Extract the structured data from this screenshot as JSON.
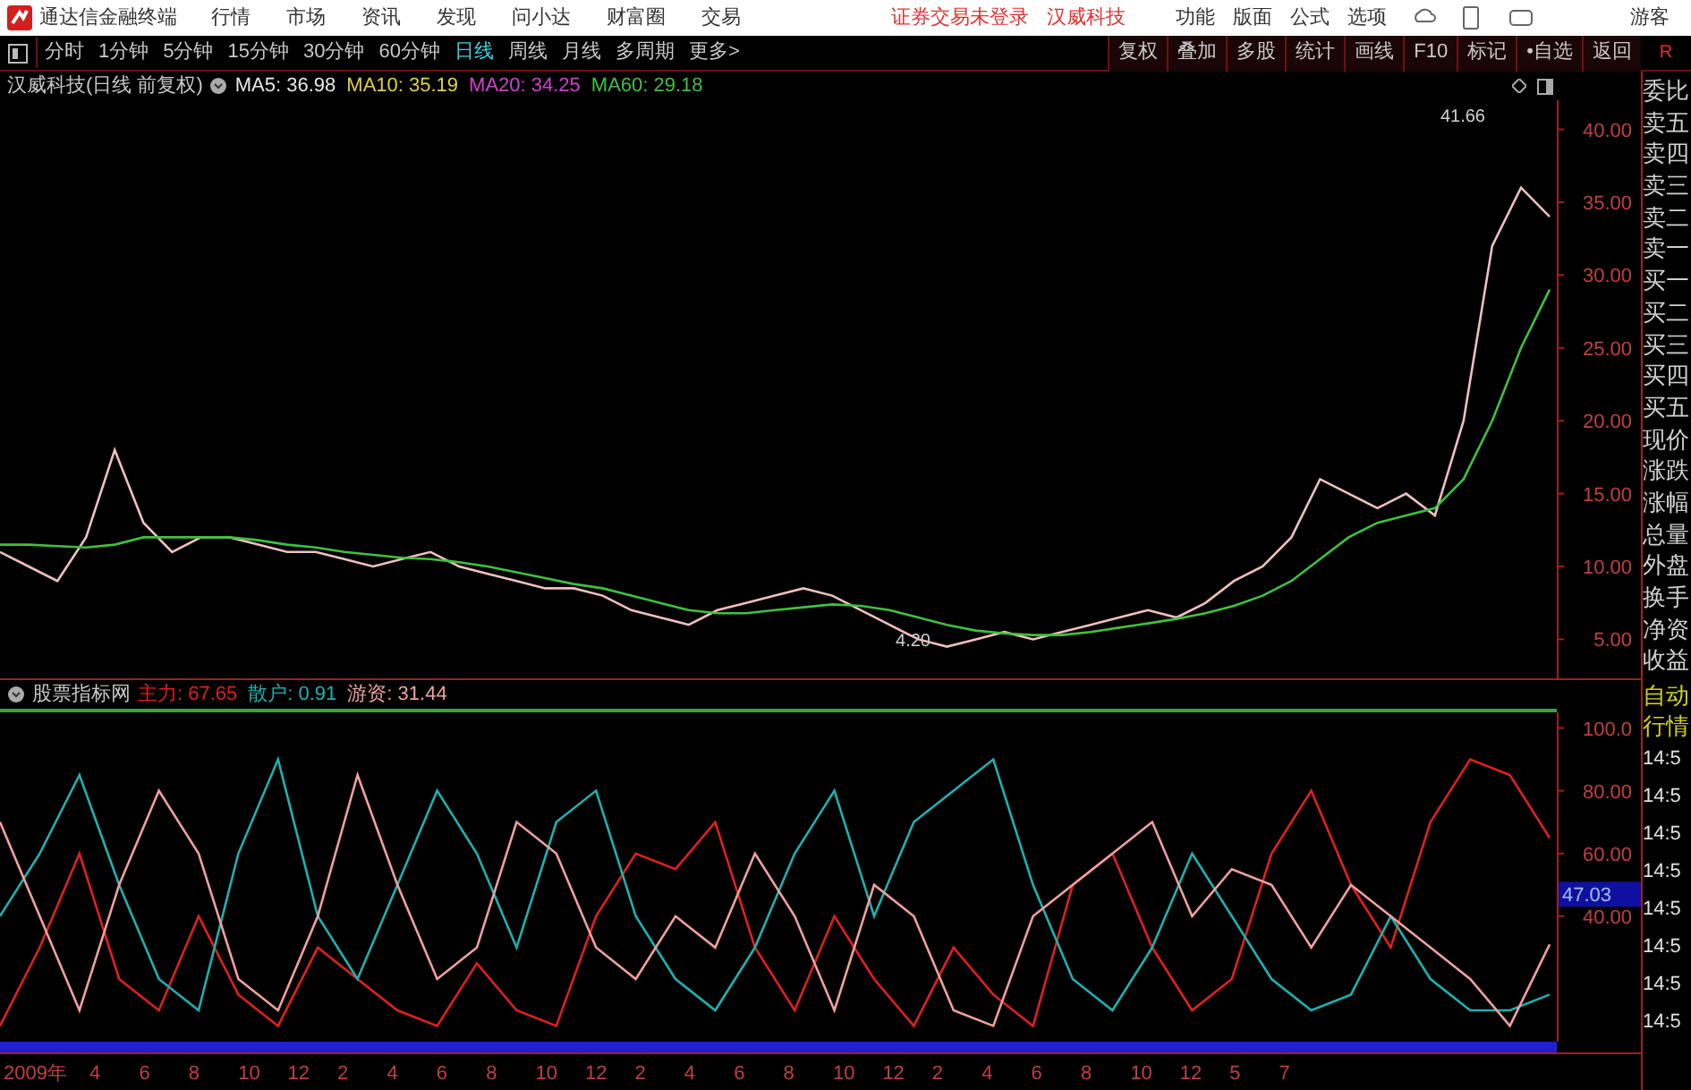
{
  "app_title": "通达信金融终端",
  "menu": [
    "行情",
    "市场",
    "资讯",
    "发现",
    "问小达",
    "财富圈",
    "交易"
  ],
  "login_status": "证券交易未登录",
  "stock_name": "汉威科技",
  "tools": [
    "功能",
    "版面",
    "公式",
    "选项"
  ],
  "user": "游客",
  "periods": [
    {
      "label": "分时",
      "selected": false
    },
    {
      "label": "1分钟",
      "selected": false
    },
    {
      "label": "5分钟",
      "selected": false
    },
    {
      "label": "15分钟",
      "selected": false
    },
    {
      "label": "30分钟",
      "selected": false
    },
    {
      "label": "60分钟",
      "selected": false
    },
    {
      "label": "日线",
      "selected": true
    },
    {
      "label": "周线",
      "selected": false
    },
    {
      "label": "月线",
      "selected": false
    },
    {
      "label": "多周期",
      "selected": false
    },
    {
      "label": "更多>",
      "selected": false
    }
  ],
  "actions": [
    "复权",
    "叠加",
    "多股",
    "统计",
    "画线",
    "F10",
    "标记",
    "•自选",
    "返回"
  ],
  "corner": "R",
  "main_chart": {
    "title": "汉威科技(日线 前复权)",
    "ma": [
      {
        "label": "MA5: 36.98",
        "color": "#e8e8e8"
      },
      {
        "label": "MA10: 35.19",
        "color": "#e0d040"
      },
      {
        "label": "MA20: 34.25",
        "color": "#d040d0"
      },
      {
        "label": "MA60: 29.18",
        "color": "#40c040"
      }
    ],
    "chart_data": {
      "type": "line",
      "ylim": [
        2.2,
        42
      ],
      "yticks": [
        {
          "value": 5,
          "label": "5.00"
        },
        {
          "value": 10,
          "label": "10.00"
        },
        {
          "value": 15,
          "label": "15.00"
        },
        {
          "value": 20,
          "label": "20.00"
        },
        {
          "value": 25,
          "label": "25.00"
        },
        {
          "value": 30,
          "label": "30.00"
        },
        {
          "value": 35,
          "label": "35.00"
        },
        {
          "value": 40,
          "label": "40.00"
        }
      ],
      "series": [
        {
          "color": "#f0c0c0",
          "values": [
            11,
            10,
            9,
            12,
            18,
            13,
            11,
            12,
            12,
            11.5,
            11,
            11,
            10.5,
            10,
            10.5,
            11,
            10,
            9.5,
            9,
            8.5,
            8.5,
            8,
            7,
            6.5,
            6,
            7,
            7.5,
            8,
            8.5,
            8,
            7,
            6,
            5,
            4.5,
            5,
            5.5,
            5,
            5.5,
            6,
            6.5,
            7,
            6.5,
            7.5,
            9,
            10,
            12,
            16,
            15,
            14,
            15,
            13.5,
            20,
            32,
            36,
            34
          ]
        },
        {
          "color": "#40c040",
          "values": [
            11.5,
            11.5,
            11.4,
            11.3,
            11.5,
            12,
            12,
            12,
            12,
            11.8,
            11.5,
            11.3,
            11,
            10.8,
            10.6,
            10.5,
            10.3,
            10,
            9.6,
            9.2,
            8.8,
            8.5,
            8,
            7.5,
            7,
            6.8,
            6.8,
            7,
            7.2,
            7.4,
            7.3,
            7,
            6.5,
            6,
            5.6,
            5.4,
            5.3,
            5.3,
            5.5,
            5.8,
            6.1,
            6.4,
            6.8,
            7.3,
            8,
            9,
            10.5,
            12,
            13,
            13.5,
            14,
            16,
            20,
            25,
            29
          ]
        }
      ],
      "annotations": [
        "41.66",
        "4.20"
      ]
    }
  },
  "indicator": {
    "title": "股票指标网",
    "values": [
      {
        "label": "主力: 67.65",
        "color": "#e02020"
      },
      {
        "label": "散户: 0.91",
        "color": "#20b0b0"
      },
      {
        "label": "游资: 31.44",
        "color": "#f0a0a0"
      }
    ],
    "current_value": "47.03",
    "chart_data": {
      "type": "line",
      "ylim": [
        0,
        105
      ],
      "yticks": [
        {
          "value": 40,
          "label": "40.00"
        },
        {
          "value": 60,
          "label": "60.00"
        },
        {
          "value": 80,
          "label": "80.00"
        },
        {
          "value": 100,
          "label": "100.0"
        }
      ],
      "series": [
        {
          "color": "#e02020",
          "values": [
            5,
            30,
            60,
            20,
            10,
            40,
            15,
            5,
            30,
            20,
            10,
            5,
            25,
            10,
            5,
            40,
            60,
            55,
            70,
            30,
            10,
            40,
            20,
            5,
            30,
            15,
            5,
            50,
            60,
            30,
            10,
            20,
            60,
            80,
            50,
            30,
            70,
            90,
            85,
            65
          ]
        },
        {
          "color": "#20b0b0",
          "values": [
            40,
            60,
            85,
            50,
            20,
            10,
            60,
            90,
            40,
            20,
            50,
            80,
            60,
            30,
            70,
            80,
            40,
            20,
            10,
            30,
            60,
            80,
            40,
            70,
            80,
            90,
            50,
            20,
            10,
            30,
            60,
            40,
            20,
            10,
            15,
            40,
            20,
            10,
            10,
            15
          ]
        },
        {
          "color": "#f0a0a0",
          "values": [
            70,
            40,
            10,
            50,
            80,
            60,
            20,
            10,
            40,
            85,
            50,
            20,
            30,
            70,
            60,
            30,
            20,
            40,
            30,
            60,
            40,
            10,
            50,
            40,
            10,
            5,
            40,
            50,
            60,
            70,
            40,
            55,
            50,
            30,
            50,
            40,
            30,
            20,
            5,
            31
          ]
        }
      ]
    }
  },
  "date_axis": [
    "2009年",
    "4",
    "6",
    "8",
    "10",
    "12",
    "2",
    "4",
    "6",
    "8",
    "10",
    "12",
    "2",
    "4",
    "6",
    "8",
    "10",
    "12",
    "2",
    "4",
    "6",
    "8",
    "10",
    "12",
    "5",
    "7"
  ],
  "quote_labels": [
    "委比",
    "卖五",
    "卖四",
    "卖三",
    "卖二",
    "卖一",
    "买一",
    "买二",
    "买三",
    "买四",
    "买五",
    "现价",
    "涨跌",
    "涨幅",
    "总量",
    "外盘",
    "换手",
    "净资",
    "收益"
  ],
  "tick_panel": {
    "title": [
      "自动",
      "行情"
    ],
    "times": [
      "14:5",
      "14:5",
      "14:5",
      "14:5",
      "14:5",
      "14:5",
      "14:5",
      "14:5"
    ]
  }
}
